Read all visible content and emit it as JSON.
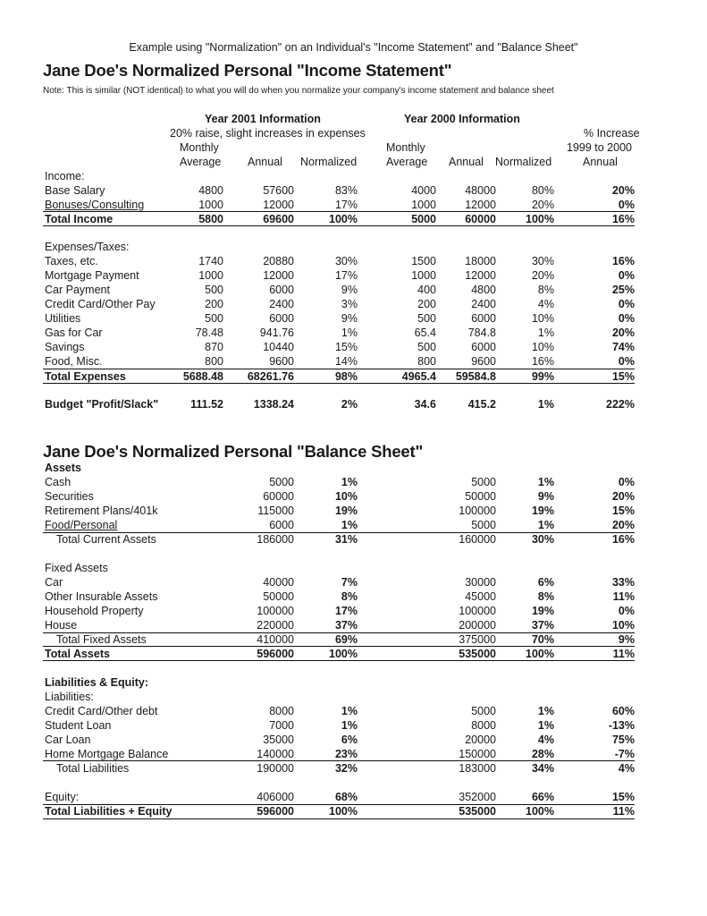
{
  "caption": "Example using \"Normalization\" on an Individual's \"Income Statement\" and \"Balance Sheet\"",
  "income_statement": {
    "title": "Jane Doe's Normalized Personal \"Income Statement\"",
    "note": "Note:  This is similar (NOT identical) to what you will do when you normalize your company's income statement and balance sheet",
    "header": {
      "year2001": "Year 2001 Information",
      "year2001_sub": "20% raise, slight increases in expenses",
      "year2000": "Year 2000 Information",
      "pct_increase_1": "% Increase",
      "pct_increase_2": "1999 to 2000",
      "pct_increase_3": "Annual",
      "monthly": "Monthly",
      "average": "Average",
      "annual": "Annual",
      "normalized": "Normalized"
    },
    "income_label": "Income:",
    "income_rows": [
      {
        "label": "Base Salary",
        "m01": "4800",
        "a01": "57600",
        "n01": "83%",
        "m00": "4000",
        "a00": "48000",
        "n00": "80%",
        "inc": "20%"
      },
      {
        "label": "Bonuses/Consulting",
        "m01": "1000",
        "a01": "12000",
        "n01": "17%",
        "m00": "1000",
        "a00": "12000",
        "n00": "20%",
        "inc": "0%"
      }
    ],
    "total_income": {
      "label": "Total Income",
      "m01": "5800",
      "a01": "69600",
      "n01": "100%",
      "m00": "5000",
      "a00": "60000",
      "n00": "100%",
      "inc": "16%"
    },
    "expenses_label": "Expenses/Taxes:",
    "expense_rows": [
      {
        "label": "Taxes, etc.",
        "m01": "1740",
        "a01": "20880",
        "n01": "30%",
        "m00": "1500",
        "a00": "18000",
        "n00": "30%",
        "inc": "16%"
      },
      {
        "label": "Mortgage Payment",
        "m01": "1000",
        "a01": "12000",
        "n01": "17%",
        "m00": "1000",
        "a00": "12000",
        "n00": "20%",
        "inc": "0%"
      },
      {
        "label": "Car Payment",
        "m01": "500",
        "a01": "6000",
        "n01": "9%",
        "m00": "400",
        "a00": "4800",
        "n00": "8%",
        "inc": "25%"
      },
      {
        "label": "Credit Card/Other Pay",
        "m01": "200",
        "a01": "2400",
        "n01": "3%",
        "m00": "200",
        "a00": "2400",
        "n00": "4%",
        "inc": "0%"
      },
      {
        "label": "Utilities",
        "m01": "500",
        "a01": "6000",
        "n01": "9%",
        "m00": "500",
        "a00": "6000",
        "n00": "10%",
        "inc": "0%"
      },
      {
        "label": "Gas for Car",
        "m01": "78.48",
        "a01": "941.76",
        "n01": "1%",
        "m00": "65.4",
        "a00": "784.8",
        "n00": "1%",
        "inc": "20%"
      },
      {
        "label": "Savings",
        "m01": "870",
        "a01": "10440",
        "n01": "15%",
        "m00": "500",
        "a00": "6000",
        "n00": "10%",
        "inc": "74%"
      },
      {
        "label": "Food, Misc.",
        "m01": "800",
        "a01": "9600",
        "n01": "14%",
        "m00": "800",
        "a00": "9600",
        "n00": "16%",
        "inc": "0%"
      }
    ],
    "total_expenses": {
      "label": "Total Expenses",
      "m01": "5688.48",
      "a01": "68261.76",
      "n01": "98%",
      "m00": "4965.4",
      "a00": "59584.8",
      "n00": "99%",
      "inc": "15%"
    },
    "budget": {
      "label": "Budget \"Profit/Slack\"",
      "m01": "111.52",
      "a01": "1338.24",
      "n01": "2%",
      "m00": "34.6",
      "a00": "415.2",
      "n00": "1%",
      "inc": "222%"
    }
  },
  "balance_sheet": {
    "title": "Jane Doe's Normalized Personal \"Balance Sheet\"",
    "assets_label": "Assets",
    "current_assets": [
      {
        "label": "Cash",
        "a01": "5000",
        "n01": "1%",
        "a00": "5000",
        "n00": "1%",
        "inc": "0%"
      },
      {
        "label": "Securities",
        "a01": "60000",
        "n01": "10%",
        "a00": "50000",
        "n00": "9%",
        "inc": "20%"
      },
      {
        "label": "Retirement Plans/401k",
        "a01": "115000",
        "n01": "19%",
        "a00": "100000",
        "n00": "19%",
        "inc": "15%"
      },
      {
        "label": "Food/Personal",
        "a01": "6000",
        "n01": "1%",
        "a00": "5000",
        "n00": "1%",
        "inc": "20%"
      }
    ],
    "total_current_assets": {
      "label": "Total Current Assets",
      "a01": "186000",
      "n01": "31%",
      "a00": "160000",
      "n00": "30%",
      "inc": "16%"
    },
    "fixed_assets_label": "Fixed Assets",
    "fixed_assets": [
      {
        "label": "Car",
        "a01": "40000",
        "n01": "7%",
        "a00": "30000",
        "n00": "6%",
        "inc": "33%"
      },
      {
        "label": "Other Insurable Assets",
        "a01": "50000",
        "n01": "8%",
        "a00": "45000",
        "n00": "8%",
        "inc": "11%"
      },
      {
        "label": "Household Property",
        "a01": "100000",
        "n01": "17%",
        "a00": "100000",
        "n00": "19%",
        "inc": "0%"
      },
      {
        "label": "House",
        "a01": "220000",
        "n01": "37%",
        "a00": "200000",
        "n00": "37%",
        "inc": "10%"
      }
    ],
    "total_fixed_assets": {
      "label": "Total Fixed Assets",
      "a01": "410000",
      "n01": "69%",
      "a00": "375000",
      "n00": "70%",
      "inc": "9%"
    },
    "total_assets": {
      "label": "Total Assets",
      "a01": "596000",
      "n01": "100%",
      "a00": "535000",
      "n00": "100%",
      "inc": "11%"
    },
    "liab_equity_label": "Liabilities & Equity:",
    "liabilities_label": "Liabilities:",
    "liabilities": [
      {
        "label": "Credit Card/Other debt",
        "a01": "8000",
        "n01": "1%",
        "a00": "5000",
        "n00": "1%",
        "inc": "60%"
      },
      {
        "label": "Student Loan",
        "a01": "7000",
        "n01": "1%",
        "a00": "8000",
        "n00": "1%",
        "inc": "-13%"
      },
      {
        "label": "Car Loan",
        "a01": "35000",
        "n01": "6%",
        "a00": "20000",
        "n00": "4%",
        "inc": "75%"
      },
      {
        "label": "Home Mortgage Balance",
        "a01": "140000",
        "n01": "23%",
        "a00": "150000",
        "n00": "28%",
        "inc": "-7%"
      }
    ],
    "total_liabilities": {
      "label": "Total Liabilities",
      "a01": "190000",
      "n01": "32%",
      "a00": "183000",
      "n00": "34%",
      "inc": "4%"
    },
    "equity": {
      "label": "Equity:",
      "a01": "406000",
      "n01": "68%",
      "a00": "352000",
      "n00": "66%",
      "inc": "15%"
    },
    "total_liab_equity": {
      "label": "Total Liabilities + Equity",
      "a01": "596000",
      "n01": "100%",
      "a00": "535000",
      "n00": "100%",
      "inc": "11%"
    }
  }
}
